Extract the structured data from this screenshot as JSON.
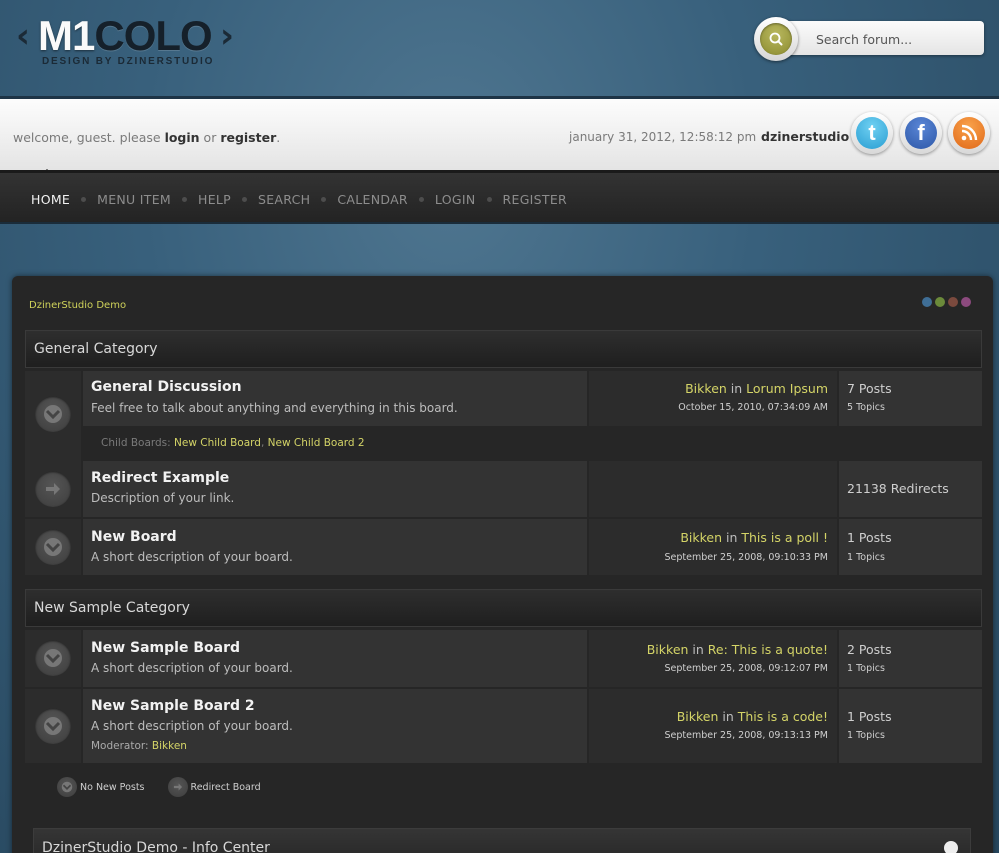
{
  "header": {
    "logo_text": "M1COLO",
    "logo_tagline": "DESIGN BY DZINERSTUDIO",
    "search_placeholder": "Search forum..."
  },
  "userbar": {
    "welcome_prefix": "welcome, guest. please ",
    "login_label": "login",
    "or_text": " or ",
    "register_label": "register",
    "period": ".",
    "datetime": "january 31, 2012, 12:58:12 pm",
    "sitename": "dzinerstudio"
  },
  "nav": {
    "items": [
      {
        "label": "HOME"
      },
      {
        "label": "MENU ITEM"
      },
      {
        "label": "HELP"
      },
      {
        "label": "SEARCH"
      },
      {
        "label": "CALENDAR"
      },
      {
        "label": "LOGIN"
      },
      {
        "label": "REGISTER"
      }
    ]
  },
  "forum": {
    "breadcrumb": "DzinerStudio Demo",
    "dot_colors": [
      "#3f6e96",
      "#6b8a3a",
      "#7b4a3e",
      "#8c4a7e"
    ],
    "categories": [
      {
        "title": "General Category",
        "boards": [
          {
            "title": "General Discussion",
            "description": "Feel free to talk about anything and everything in this board.",
            "last_user": "Bikken",
            "in": " in ",
            "last_topic": "Lorum Ipsum",
            "last_date": "October 15, 2010, 07:34:09 AM",
            "stat1": "7 Posts",
            "stat2": "5 Topics",
            "child_label": "Child Boards: ",
            "child1": "New Child Board",
            "child_sep": ", ",
            "child2": "New Child Board 2"
          },
          {
            "title": "Redirect Example",
            "description": "Description of your link.",
            "stat1": "21138 Redirects"
          },
          {
            "title": "New Board",
            "description": "A short description of your board.",
            "last_user": "Bikken",
            "in": " in ",
            "last_topic": "This is a poll !",
            "last_date": "September 25, 2008, 09:10:33 PM",
            "stat1": "1 Posts",
            "stat2": "1 Topics"
          }
        ]
      },
      {
        "title": "New Sample Category",
        "boards": [
          {
            "title": "New Sample Board",
            "description": "A short description of your board.",
            "last_user": "Bikken",
            "in": " in ",
            "last_topic": "Re: This is a quote!",
            "last_date": "September 25, 2008, 09:12:07 PM",
            "stat1": "2 Posts",
            "stat2": "1 Topics"
          },
          {
            "title": "New Sample Board 2",
            "description": "A short description of your board.",
            "moderator_label": "Moderator: ",
            "moderator": "Bikken",
            "last_user": "Bikken",
            "in": " in ",
            "last_topic": "This is a code!",
            "last_date": "September 25, 2008, 09:13:13 PM",
            "stat1": "1 Posts",
            "stat2": "1 Topics"
          }
        ]
      }
    ],
    "legend": {
      "no_new": "No New Posts",
      "redirect": "Redirect Board"
    },
    "info_center_title": "DzinerStudio Demo - Info Center"
  }
}
